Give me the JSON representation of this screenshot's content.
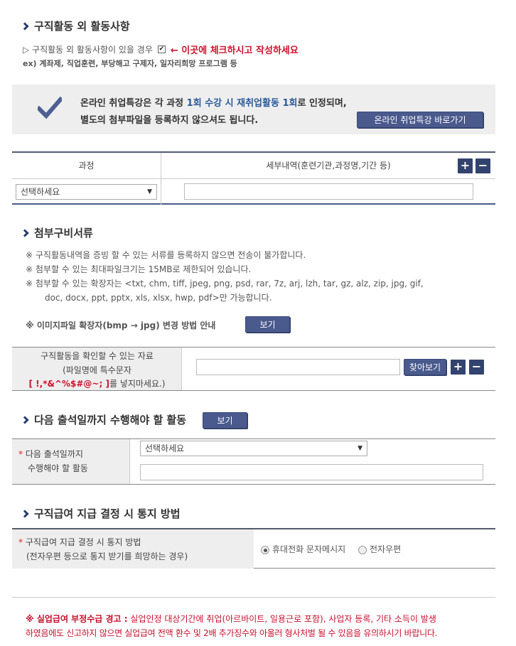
{
  "section1": {
    "title": "구직활동 외 활동사항",
    "line1_prefix": "▷ 구직활동 외 활동사항이 있을 경우",
    "check_note": "← 이곳에 체크하시고 작성하세요",
    "example": "ex) 계좌제, 직업훈련, 부당해고 구제자, 일자리희망 프로그램 등"
  },
  "info_box": {
    "line1_a": "온라인 취업특강은 각 과정 ",
    "line1_hl": "1회 수강 시 재취업활동 1회",
    "line1_b": "로 인정되며,",
    "line2": "별도의 첨부파일을 등록하지 않으셔도 됩니다.",
    "button": "온라인 취업특강 바로가기"
  },
  "course_table": {
    "col1": "과정",
    "col2": "세부내역(훈련기관,과정명,기간 등)",
    "select_value": "선택하세요",
    "detail_value": "",
    "plus": "+",
    "minus": "−"
  },
  "section2": {
    "title": "첨부구비서류",
    "notes": [
      "※ 구직활동내역을 증빙 할 수 있는 서류를 등록하지 않으면 전송이 불가합니다.",
      "※ 첨부할 수 있는 최대파일크기는 15MB로 제한되어 있습니다.",
      "※ 첨부할 수 있는 확장자는 <txt, chm, tiff, jpeg, png, psd, rar, 7z, arj, lzh, tar, gz, alz, zip, jpg, gif,",
      "doc, docx, ppt, pptx, xls, xlsx, hwp, pdf>만 가능합니다."
    ],
    "image_guide": "※ 이미지파일 확장자(bmp → jpg) 변경 방법 안내",
    "view_button": "보기"
  },
  "file_table": {
    "label1": "구직활동을 확인할 수 있는 자료",
    "label2": "(파일명에 특수문자",
    "label3_red": "[ !,*&^%$#@~; ]",
    "label3_b": "를 넣지마세요.)",
    "file_value": "",
    "browse": "찾아보기",
    "plus": "+",
    "minus": "−"
  },
  "section3": {
    "title": "다음 출석일까지 수행해야 할 활동",
    "view_button": "보기",
    "label1": "다음 출석일까지",
    "label2": "수행해야 할 활동",
    "select_value": "선택하세요",
    "text_value": ""
  },
  "section4": {
    "title": "구직급여 지급 결정 시 통지 방법",
    "label1": "구직급여 지급 결정 시 통지 방법",
    "label2": "(전자우편 등으로 통지 받기를 희망하는 경우)",
    "radio1": "휴대전화 문자메시지",
    "radio2": "전자우편"
  },
  "warning": {
    "title": "※ 실업급여 부정수급 경고 :",
    "line1": " 실업인정 대상기간에 취업(아르바이트, 일용근로 포함), 사업자 등록, 기타 소득이 발생",
    "line2": "하였음에도 신고하지 않으면 실업급여 전액 환수 및 2배 추가징수와 아울러 형사처벌 될 수 있음을 유의하시기 바랍니다."
  }
}
